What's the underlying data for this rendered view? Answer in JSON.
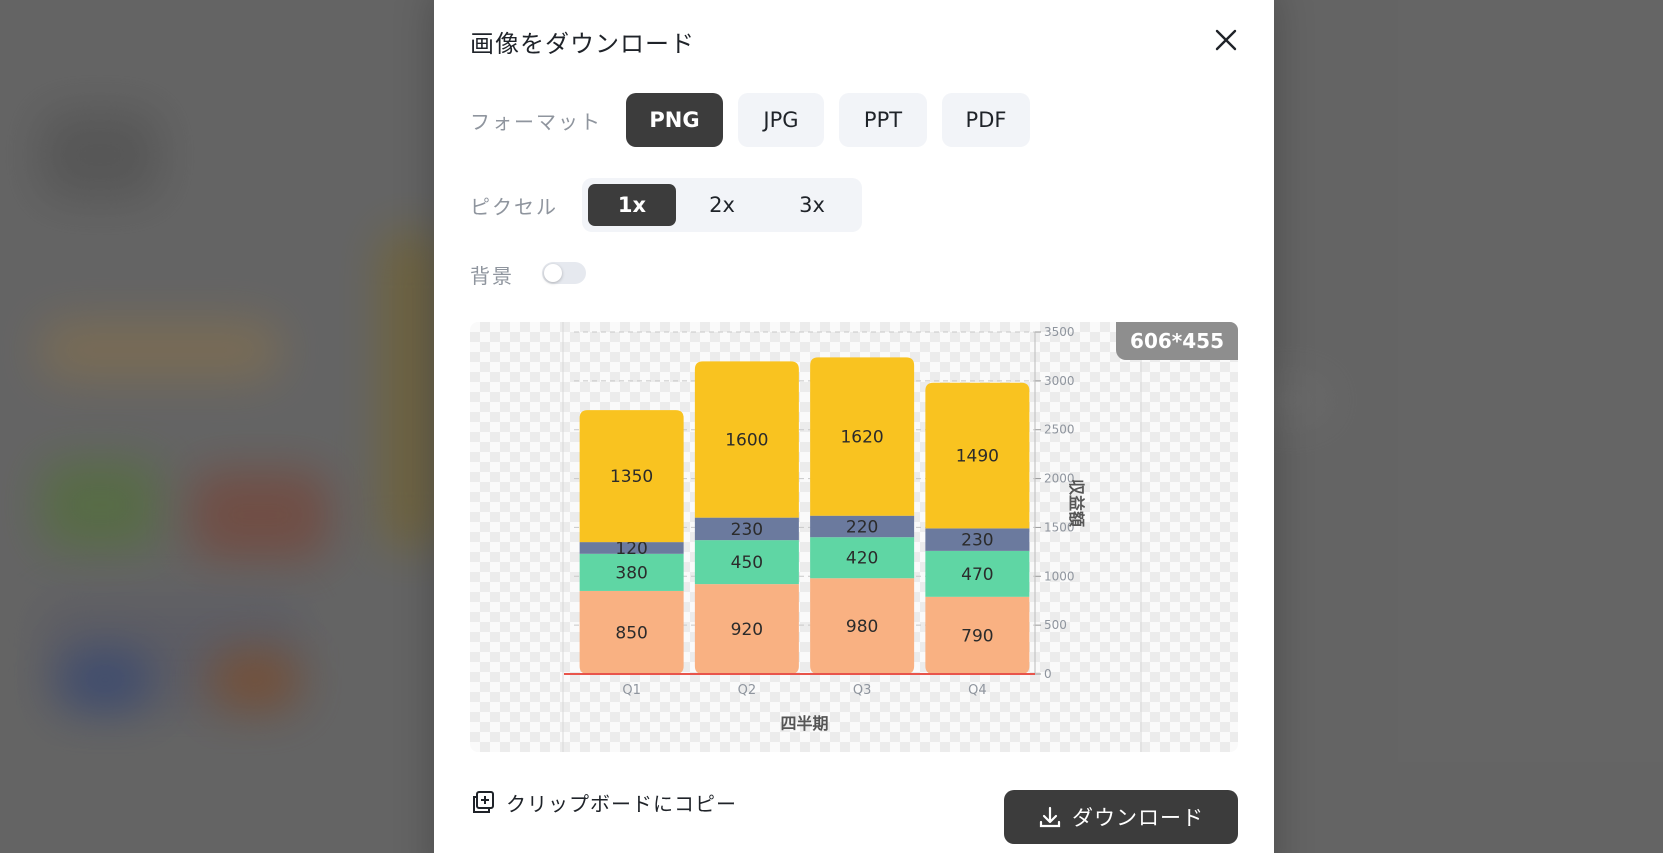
{
  "modal": {
    "title": "画像をダウンロード",
    "format_label": "フォーマット",
    "formats": [
      "PNG",
      "JPG",
      "PPT",
      "PDF"
    ],
    "selected_format": "PNG",
    "pixel_label": "ピクセル",
    "pixels": [
      "1x",
      "2x",
      "3x"
    ],
    "selected_pixel": "1x",
    "background_label": "背景",
    "background_enabled": false,
    "preview_size": "606*455",
    "copy_label": "クリップボードにコピー",
    "download_label": "ダウンロード"
  },
  "colors": {
    "accent_dark": "#3c3c3c",
    "segment_1": "#f9b182",
    "segment_2": "#5fd6a4",
    "segment_3": "#6b7a9e",
    "segment_4": "#f9c320",
    "baseline": "#e8544b"
  },
  "icons": [
    "close-icon",
    "copy-icon",
    "download-icon"
  ],
  "chart_data": {
    "type": "bar",
    "stacked": true,
    "categories": [
      "Q1",
      "Q2",
      "Q3",
      "Q4"
    ],
    "series": [
      {
        "values": [
          850,
          920,
          980,
          790
        ]
      },
      {
        "values": [
          380,
          450,
          420,
          470
        ]
      },
      {
        "values": [
          120,
          230,
          220,
          230
        ]
      },
      {
        "values": [
          1350,
          1600,
          1620,
          1490
        ]
      }
    ],
    "xlabel": "四半期",
    "ylabel": "収益額",
    "ylim": [
      0,
      3500
    ],
    "yticks": [
      0,
      500,
      1000,
      1500,
      2000,
      2500,
      3000,
      3500
    ],
    "y_axis_side": "right",
    "grid": true
  }
}
